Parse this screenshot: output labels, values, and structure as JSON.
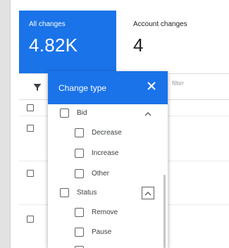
{
  "scorecards": {
    "all_changes": {
      "label": "All changes",
      "value": "4.82K"
    },
    "account_changes": {
      "label": "Account changes",
      "value": "4"
    }
  },
  "filter_bar": {
    "add_filter_label": "filter"
  },
  "change_type_panel": {
    "title": "Change type",
    "groups": [
      {
        "label": "Bid",
        "options": [
          "Decrease",
          "Increase",
          "Other"
        ]
      },
      {
        "label": "Status",
        "options": [
          "Remove",
          "Pause"
        ]
      }
    ]
  },
  "colors": {
    "accent": "#1a73e8",
    "text": "#3c4043"
  },
  "icons": [
    "filter-icon",
    "close-icon",
    "chevron-up-icon"
  ]
}
